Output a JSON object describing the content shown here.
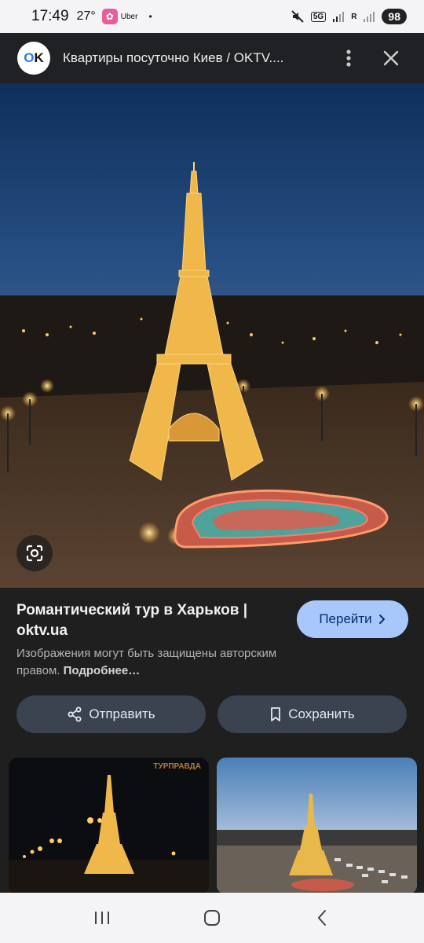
{
  "status_bar": {
    "time": "17:49",
    "temp": "27°",
    "notif_app": "Uber",
    "dot": "•",
    "network": "5G",
    "signal_extra": "R",
    "battery": "98"
  },
  "header": {
    "logo_text_o": "O",
    "logo_text_k": "K",
    "title": "Квартиры посуточно Киев / OKTV...."
  },
  "result": {
    "title": "Романтический тур в Харьков | oktv.ua",
    "visit_label": "Перейти",
    "copyright_text": "Изображения могут быть защищены авторским правом.",
    "copyright_more": "Подробнее…",
    "share_label": "Отправить",
    "save_label": "Сохранить"
  },
  "thumbnails": {
    "watermark": "ТУРПРАВДА"
  },
  "colors": {
    "accent": "#a8c7fa",
    "button_bg": "#3b4350",
    "background": "#1f1f1f"
  }
}
